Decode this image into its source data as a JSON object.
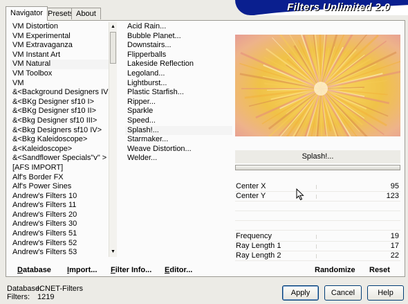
{
  "tabs": [
    {
      "label": "Navigator"
    },
    {
      "label": "Presets"
    },
    {
      "label": "About"
    }
  ],
  "title": "Filters Unlimited 2.0",
  "categories": [
    "VM Distortion",
    "VM Experimental",
    "VM Extravaganza",
    "VM Instant Art",
    "VM Natural",
    "VM Toolbox",
    "VM",
    "&<Background Designers IV>",
    "&<BKg Designer sf10 I>",
    "&<BKg Designer sf10 II>",
    "&<Bkg Designer sf10 III>",
    "&<Bkg Designers sf10 IV>",
    "&<Bkg Kaleidoscope>",
    "&<Kaleidoscope>",
    "&<Sandflower Specials\"v\" >",
    "[AFS IMPORT]",
    "Alf's Border FX",
    "Alf's Power Sines",
    "Andrew's Filters 10",
    "Andrew's Filters 11",
    "Andrew's Filters 20",
    "Andrew's Filters 30",
    "Andrew's Filters 51",
    "Andrew's Filters 52",
    "Andrew's Filters 53"
  ],
  "selected_category_index": 4,
  "filters": [
    "Acid Rain...",
    "Bubble Planet...",
    "Downstairs...",
    "Flipperballs",
    "Lakeside Reflection",
    "Legoland...",
    "Lightburst...",
    "Plastic Starfish...",
    "Ripper...",
    "Sparkle",
    "Speed...",
    "Splash!...",
    "Starmaker...",
    "Weave Distortion...",
    "Welder..."
  ],
  "selected_filter_index": 11,
  "selected_filter_label": "Splash!...",
  "params": [
    {
      "name": "Center X",
      "value": "95"
    },
    {
      "name": "Center Y",
      "value": "123"
    },
    {
      "name": "Frequency",
      "value": "19"
    },
    {
      "name": "Ray Length 1",
      "value": "17"
    },
    {
      "name": "Ray Length 2",
      "value": "22"
    }
  ],
  "buttons": {
    "database": "Database",
    "import": "Import...",
    "filter_info": "Filter Info...",
    "editor": "Editor...",
    "randomize": "Randomize",
    "reset": "Reset",
    "apply": "Apply",
    "cancel": "Cancel",
    "help": "Help"
  },
  "footer": {
    "database_label": "Database:",
    "database_value": "ICNET-Filters",
    "filters_label": "Filters:",
    "filters_value": "1219"
  },
  "colors": {
    "banner": "#0a1f8f",
    "preview_core": "#f5c542",
    "preview_edge": "#e9a79a"
  },
  "icons": {
    "scroll_up": "triangle-up-icon",
    "scroll_down": "triangle-down-icon",
    "cursor": "mouse-pointer-icon"
  }
}
